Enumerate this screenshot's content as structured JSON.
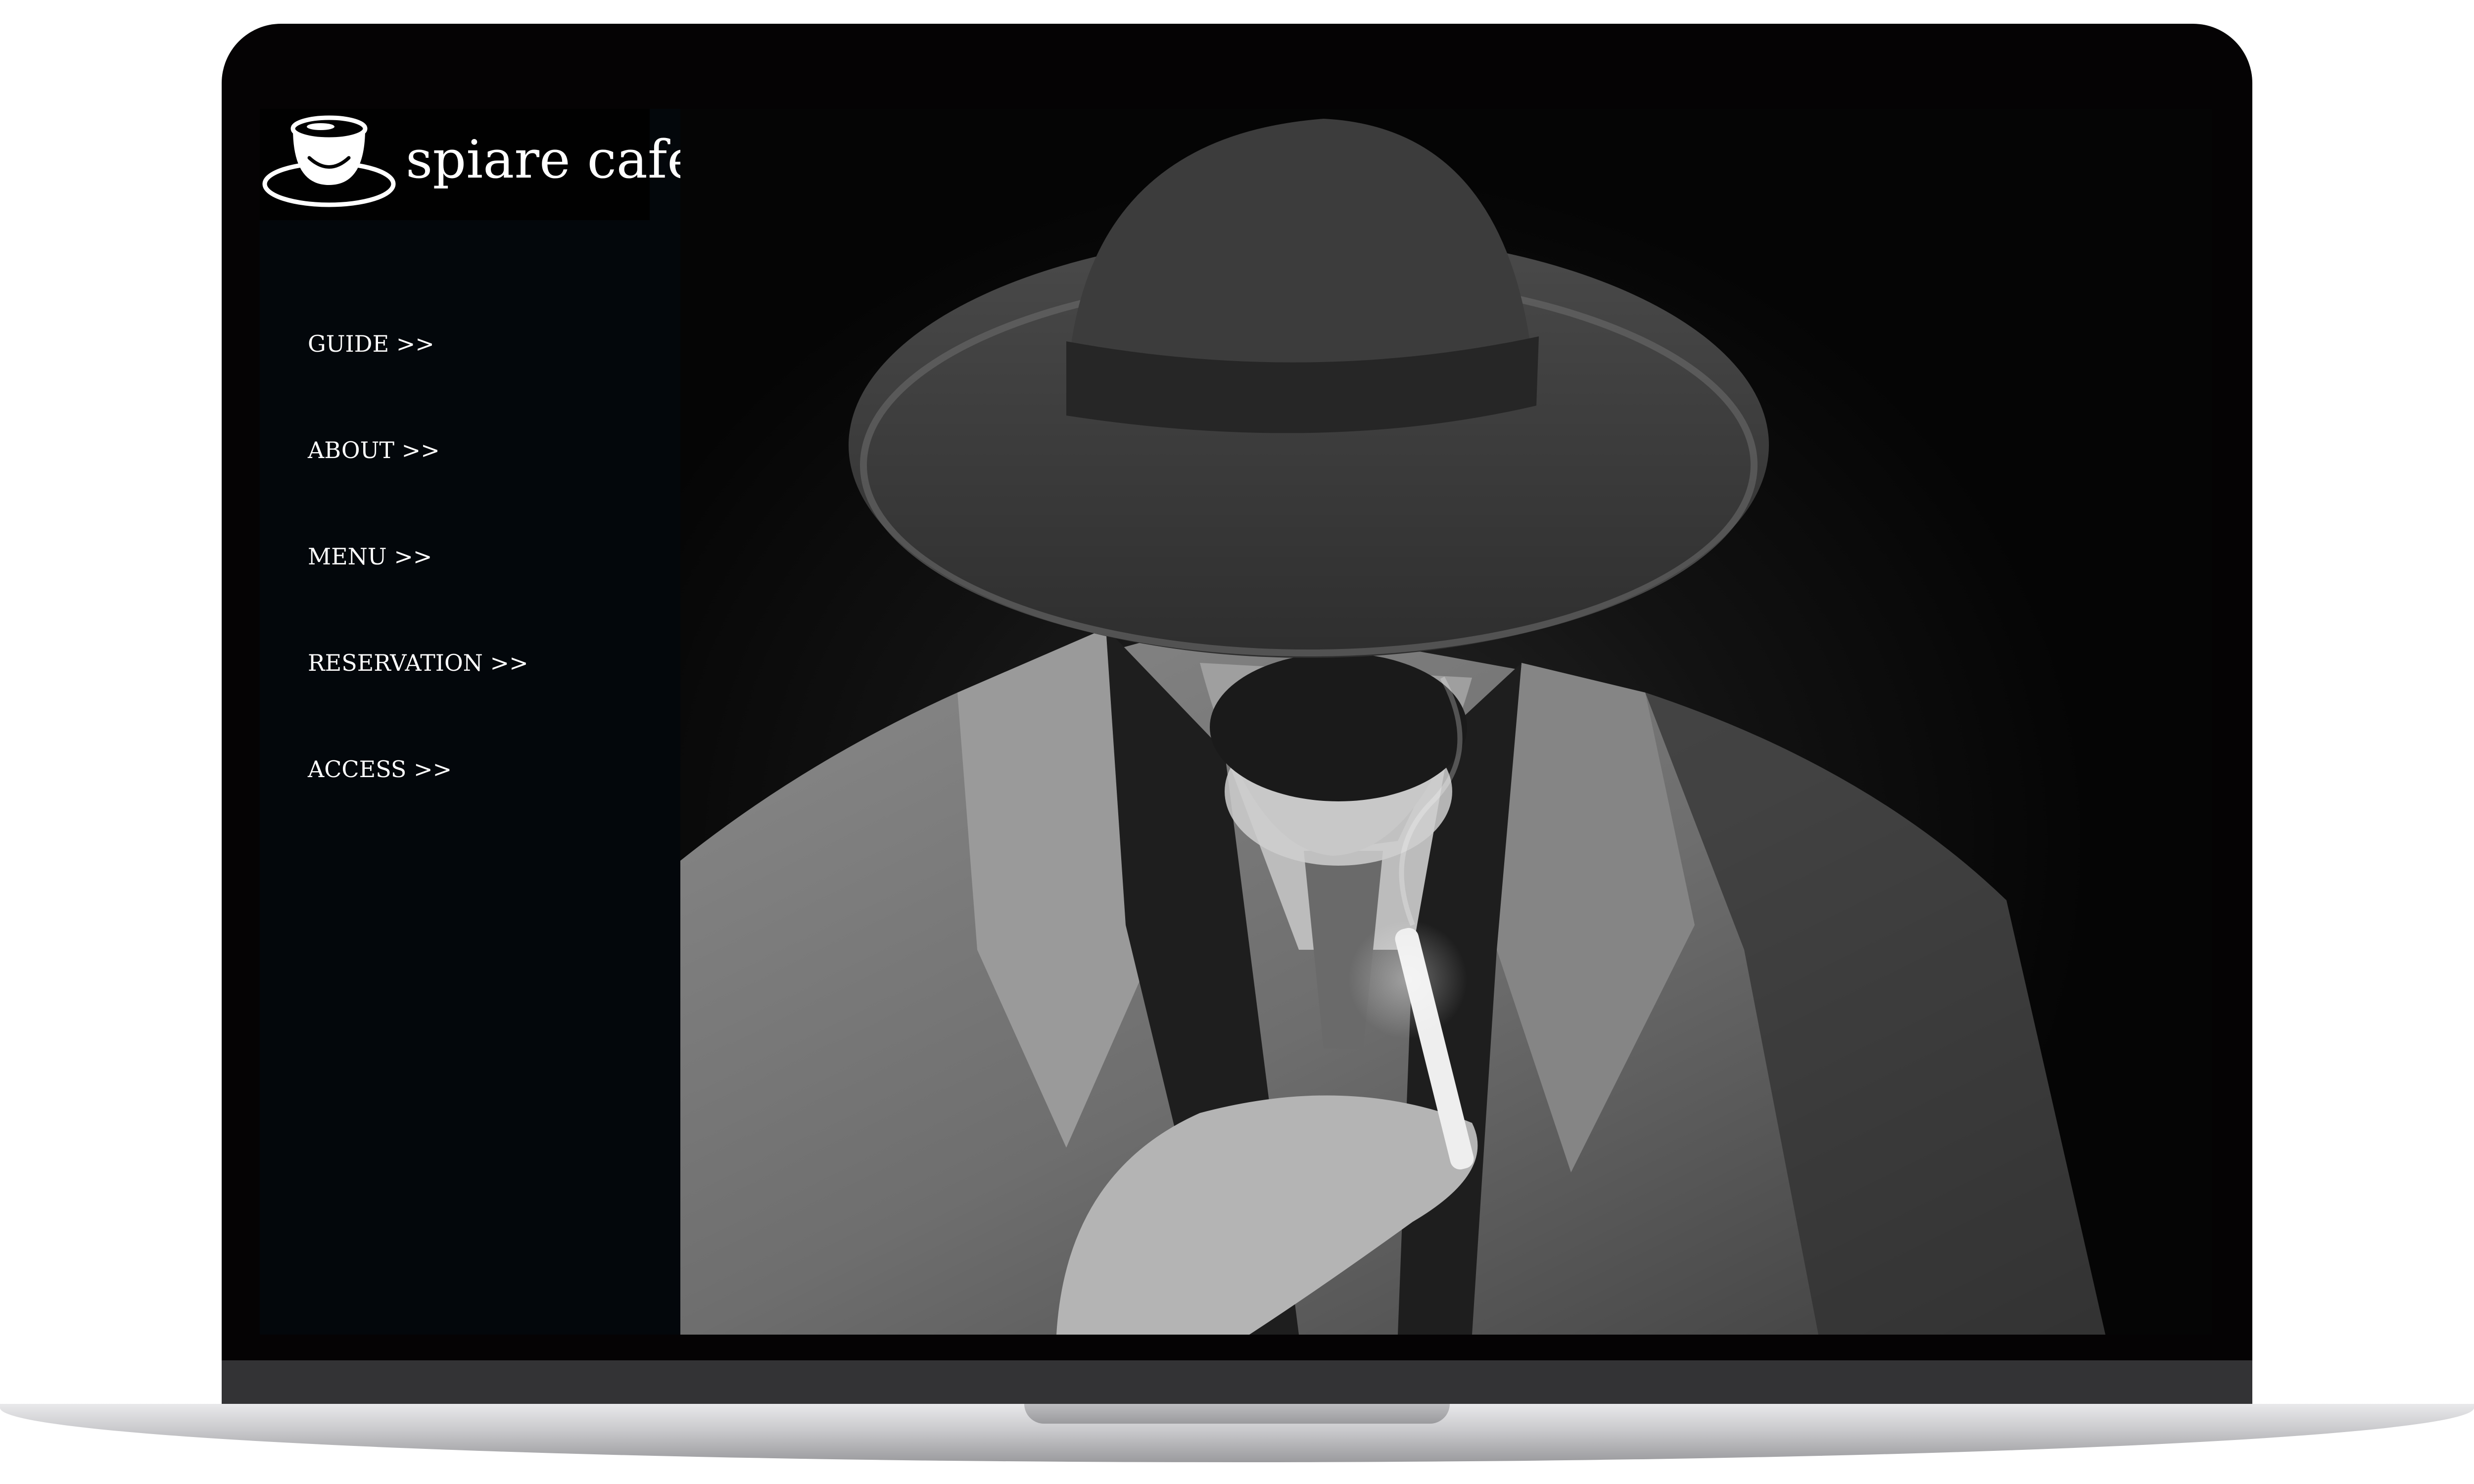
{
  "site": {
    "logo_text": "spiare cafe",
    "logo_icon": "coffee-cup-icon"
  },
  "nav": {
    "items": [
      {
        "label": "GUIDE >>"
      },
      {
        "label": "ABOUT >>"
      },
      {
        "label": "MENU >>"
      },
      {
        "label": "RESERVATION >>"
      },
      {
        "label": "ACCESS >>"
      }
    ]
  },
  "hero": {
    "image_subject": "man-in-fedora-and-trench-coat-smoking-photo"
  },
  "colors": {
    "sidebar_bg": "#03070b",
    "bezel": "#050304",
    "text": "#ffffff"
  }
}
